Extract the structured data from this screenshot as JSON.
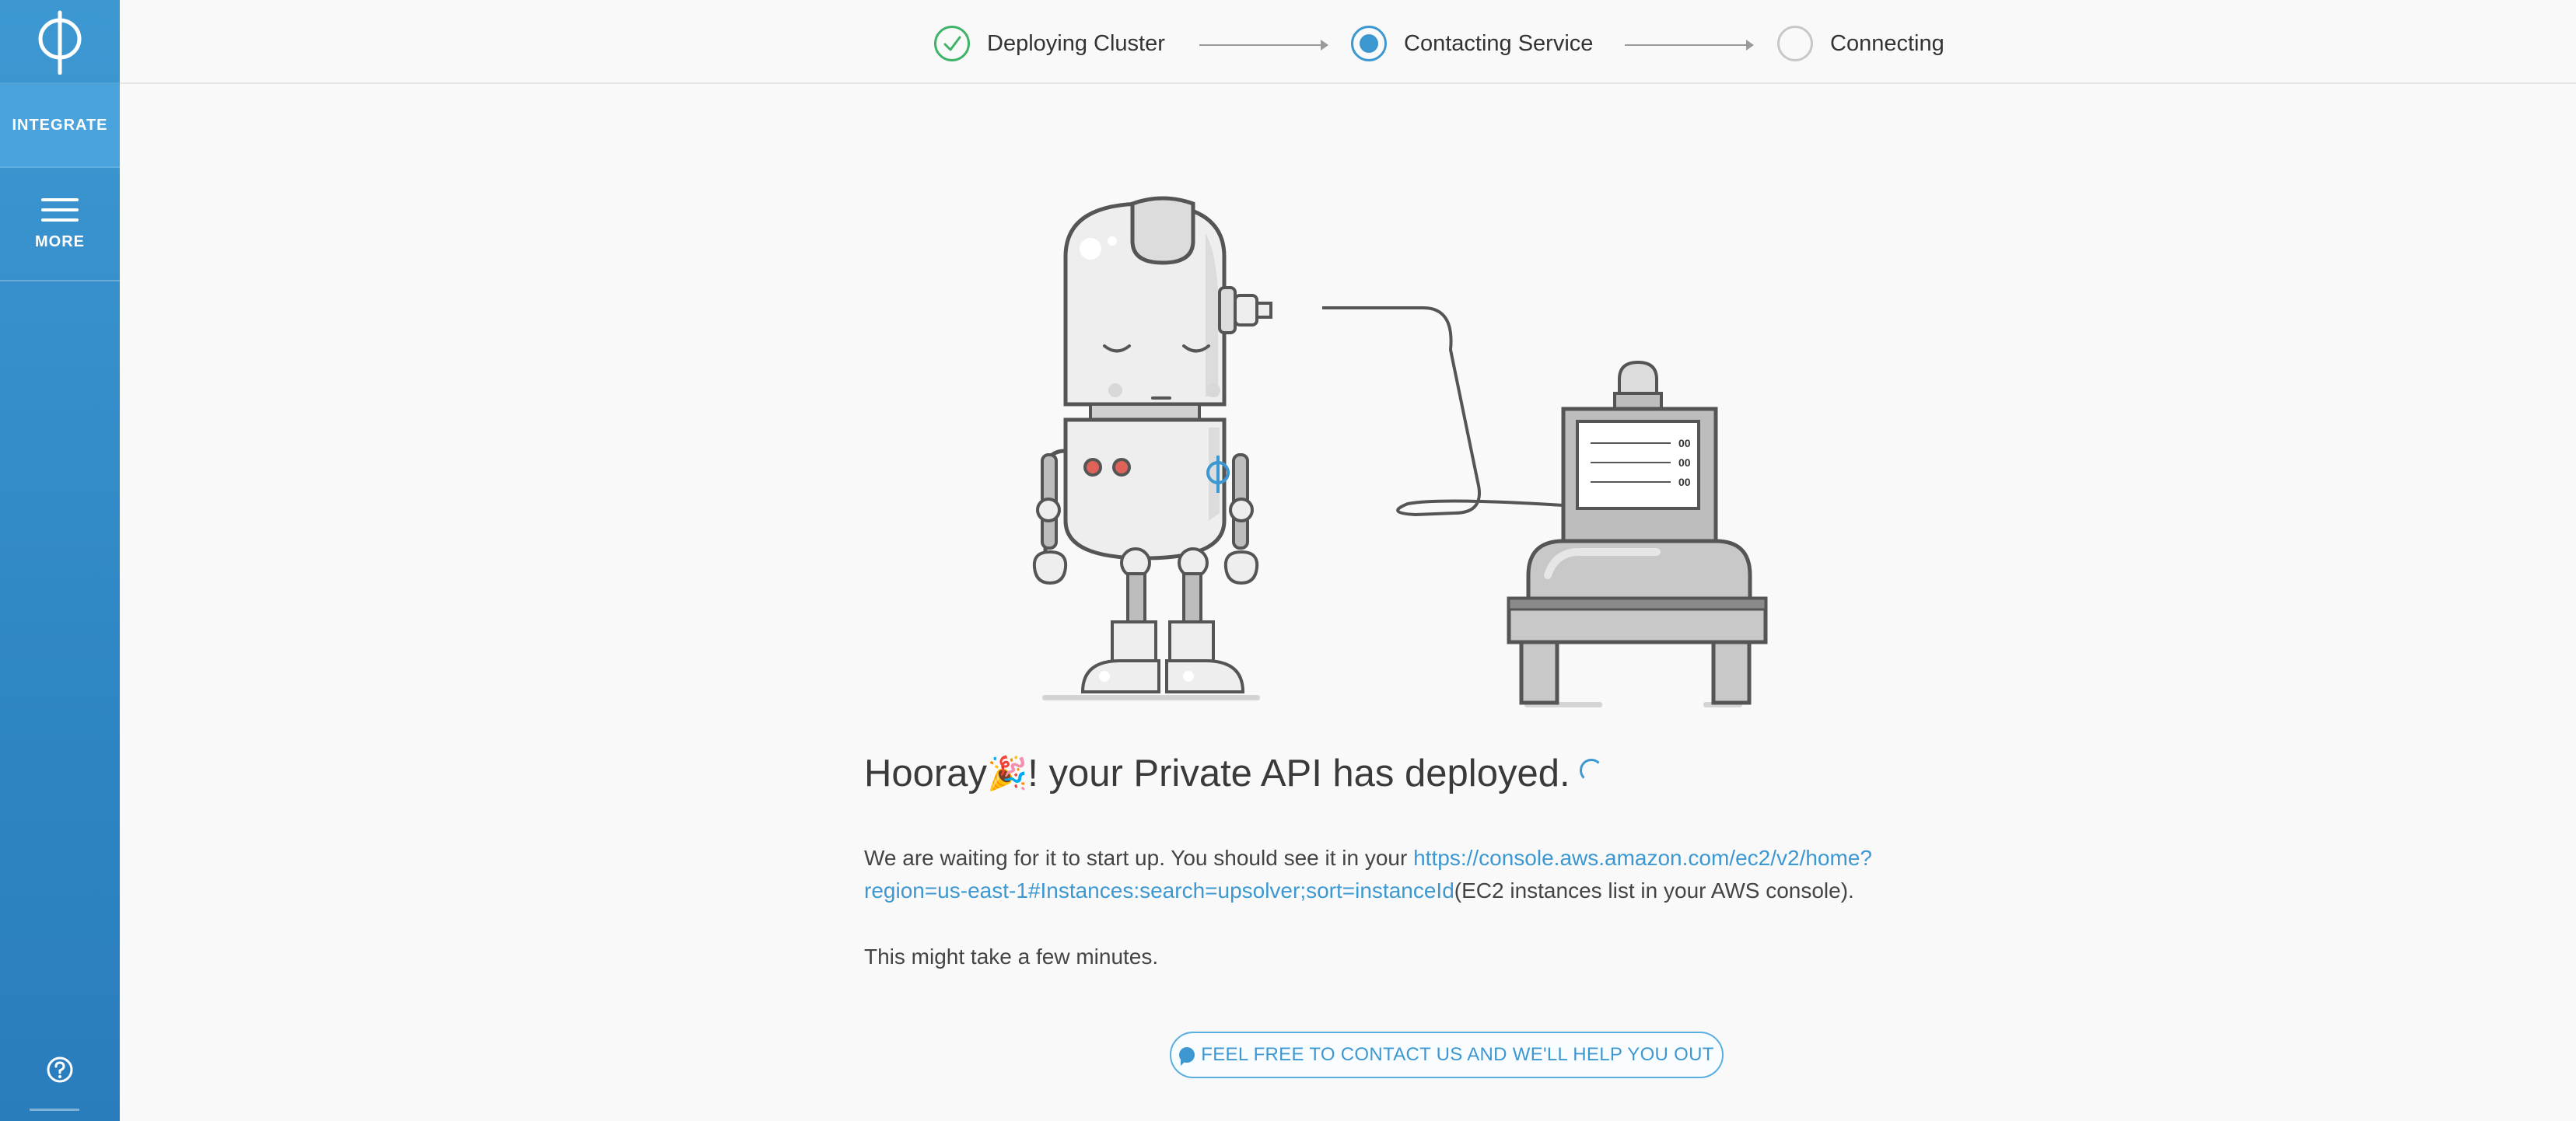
{
  "sidebar": {
    "logo_glyph": "φ",
    "integrate_label": "INTEGRATE",
    "more_label": "MORE",
    "help_icon": "question-circle-icon"
  },
  "stepper": {
    "steps": [
      {
        "label": "Deploying Cluster",
        "status": "done"
      },
      {
        "label": "Contacting Service",
        "status": "active"
      },
      {
        "label": "Connecting",
        "status": "pending"
      }
    ]
  },
  "illustration": {
    "robot_chest_glyph": "φ",
    "monitor_readout": [
      "00",
      "00",
      "00"
    ]
  },
  "main": {
    "headline_prefix": "Hooray",
    "headline_emoji": "🎉",
    "headline_suffix": "! your Private API has deployed.",
    "desc_before": "We are waiting for it to start up. You should see it in your ",
    "desc_link": "https://console.aws.amazon.com/ec2/v2/home?region=us-east-1#Instances:search=upsolver;sort=instanceId",
    "desc_after": "(EC2 instances list in your AWS console).",
    "note": "This might take a few minutes.",
    "contact_label": "FEEL FREE TO CONTACT US AND WE'LL HELP YOU OUT"
  },
  "colors": {
    "accent": "#3d98d2",
    "success": "#3fb469",
    "sidebar": "#2f86c4"
  }
}
